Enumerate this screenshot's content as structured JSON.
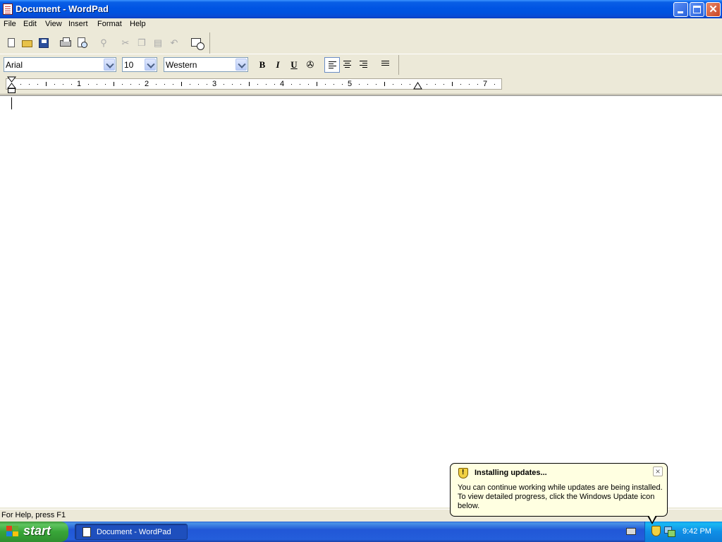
{
  "window": {
    "title": "Document - WordPad",
    "icon": "wordpad-icon"
  },
  "menu": {
    "items": [
      "File",
      "Edit",
      "View",
      "Insert",
      "Format",
      "Help"
    ]
  },
  "toolbar": {
    "buttons": [
      "new-document-icon",
      "open-folder-icon",
      "save-disk-icon",
      "print-icon",
      "print-preview-icon",
      "find-binoculars-icon",
      "cut-scissors-icon",
      "copy-icon",
      "paste-icon",
      "undo-icon",
      "date-time-icon"
    ]
  },
  "format_bar": {
    "font": "Arial",
    "size": "10",
    "script": "Western",
    "bold": "B",
    "italic": "I",
    "underline": "U",
    "alignment": "left"
  },
  "ruler": {
    "numbers": [
      "1",
      "2",
      "3",
      "4",
      "5",
      "7"
    ]
  },
  "document": {
    "text": ""
  },
  "status": {
    "help_text": "For Help, press F1"
  },
  "taskbar": {
    "start_label": "start",
    "task_label": "Document - WordPad",
    "clock": "9:42 PM"
  },
  "balloon": {
    "title": "Installing updates...",
    "body": "You can continue working while updates are being installed. To view detailed progress, click the Windows Update icon below.",
    "close": "×"
  },
  "colors": {
    "titlebar_blue": "#0054e3",
    "close_red": "#c94421",
    "taskbar_blue": "#245edb",
    "start_green": "#38a538",
    "balloon_bg": "#ffffe1"
  }
}
